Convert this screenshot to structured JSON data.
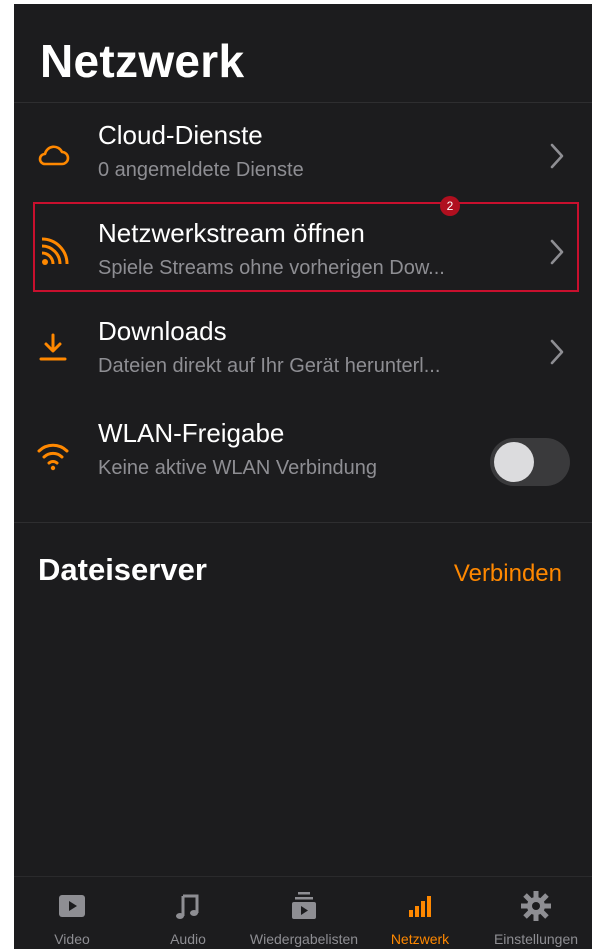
{
  "colors": {
    "accent": "#ff8800",
    "background": "#1c1c1e",
    "highlight": "#c8102e"
  },
  "header": {
    "title": "Netzwerk"
  },
  "rows": [
    {
      "icon": "cloud-icon",
      "title": "Cloud-Dienste",
      "subtitle": "0 angemeldete Dienste"
    },
    {
      "icon": "rss-icon",
      "title": "Netzwerkstream öffnen",
      "subtitle": "Spiele Streams ohne vorherigen Dow...",
      "badge": "2"
    },
    {
      "icon": "download-icon",
      "title": "Downloads",
      "subtitle": "Dateien direkt auf Ihr Gerät herunterl..."
    },
    {
      "icon": "wifi-icon",
      "title": "WLAN-Freigabe",
      "subtitle": "Keine aktive WLAN Verbindung",
      "toggle_on": false
    }
  ],
  "fileserver": {
    "title": "Dateiserver",
    "connect_label": "Verbinden"
  },
  "tabs": [
    {
      "icon": "video-icon",
      "label": "Video"
    },
    {
      "icon": "music-note-icon",
      "label": "Audio"
    },
    {
      "icon": "playlist-icon",
      "label": "Wiedergabelisten"
    },
    {
      "icon": "signal-bars-icon",
      "label": "Netzwerk",
      "active": true
    },
    {
      "icon": "gear-icon",
      "label": "Einstellungen"
    }
  ]
}
